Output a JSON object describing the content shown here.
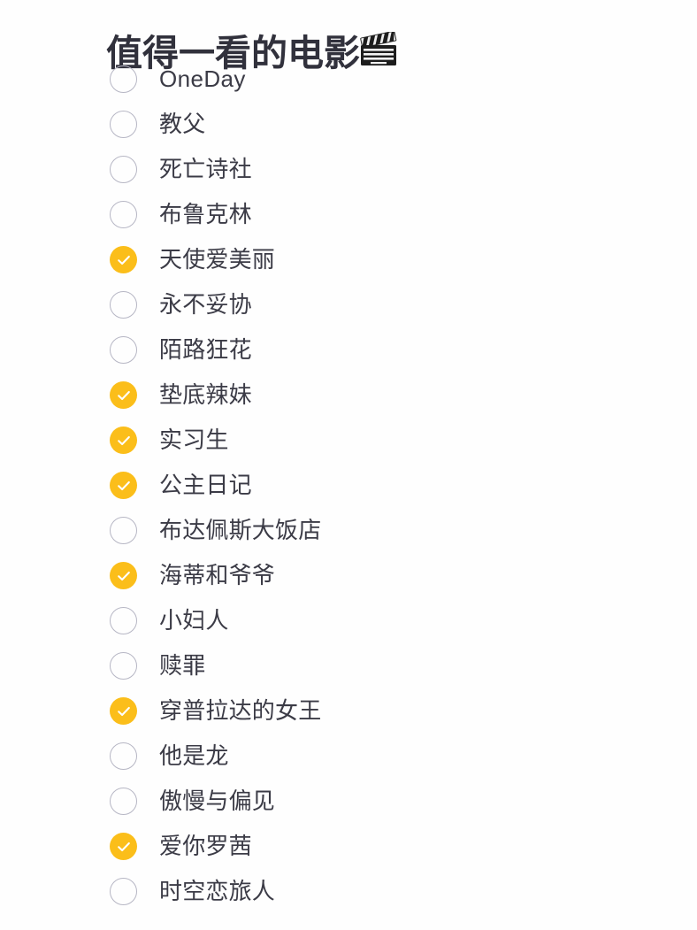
{
  "document": {
    "title": "值得一看的电影",
    "title_icon": "clapperboard-icon",
    "background_color": "#fefefe",
    "text_color": "#3b3b46"
  },
  "theme": {
    "accent_color": "#fbbe1a",
    "checkbox_border_color": "#b6b6c4",
    "check_mark_color": "#ffffff"
  },
  "checklist": {
    "total_count": 19,
    "checked_count": 7,
    "items": [
      {
        "label": "OneDay",
        "checked": false,
        "script": "latin"
      },
      {
        "label": "教父",
        "checked": false,
        "script": "han"
      },
      {
        "label": "死亡诗社",
        "checked": false,
        "script": "han"
      },
      {
        "label": "布鲁克林",
        "checked": false,
        "script": "han"
      },
      {
        "label": "天使爱美丽",
        "checked": true,
        "script": "han"
      },
      {
        "label": "永不妥协",
        "checked": false,
        "script": "han"
      },
      {
        "label": "陌路狂花",
        "checked": false,
        "script": "han"
      },
      {
        "label": "垫底辣妹",
        "checked": true,
        "script": "han"
      },
      {
        "label": "实习生",
        "checked": true,
        "script": "han"
      },
      {
        "label": "公主日记",
        "checked": true,
        "script": "han"
      },
      {
        "label": "布达佩斯大饭店",
        "checked": false,
        "script": "han"
      },
      {
        "label": "海蒂和爷爷",
        "checked": true,
        "script": "han"
      },
      {
        "label": "小妇人",
        "checked": false,
        "script": "han"
      },
      {
        "label": "赎罪",
        "checked": false,
        "script": "han"
      },
      {
        "label": "穿普拉达的女王",
        "checked": true,
        "script": "han"
      },
      {
        "label": "他是龙",
        "checked": false,
        "script": "han"
      },
      {
        "label": "傲慢与偏见",
        "checked": false,
        "script": "han"
      },
      {
        "label": "爱你罗茜",
        "checked": true,
        "script": "han"
      },
      {
        "label": "时空恋旅人",
        "checked": false,
        "script": "han"
      }
    ]
  }
}
